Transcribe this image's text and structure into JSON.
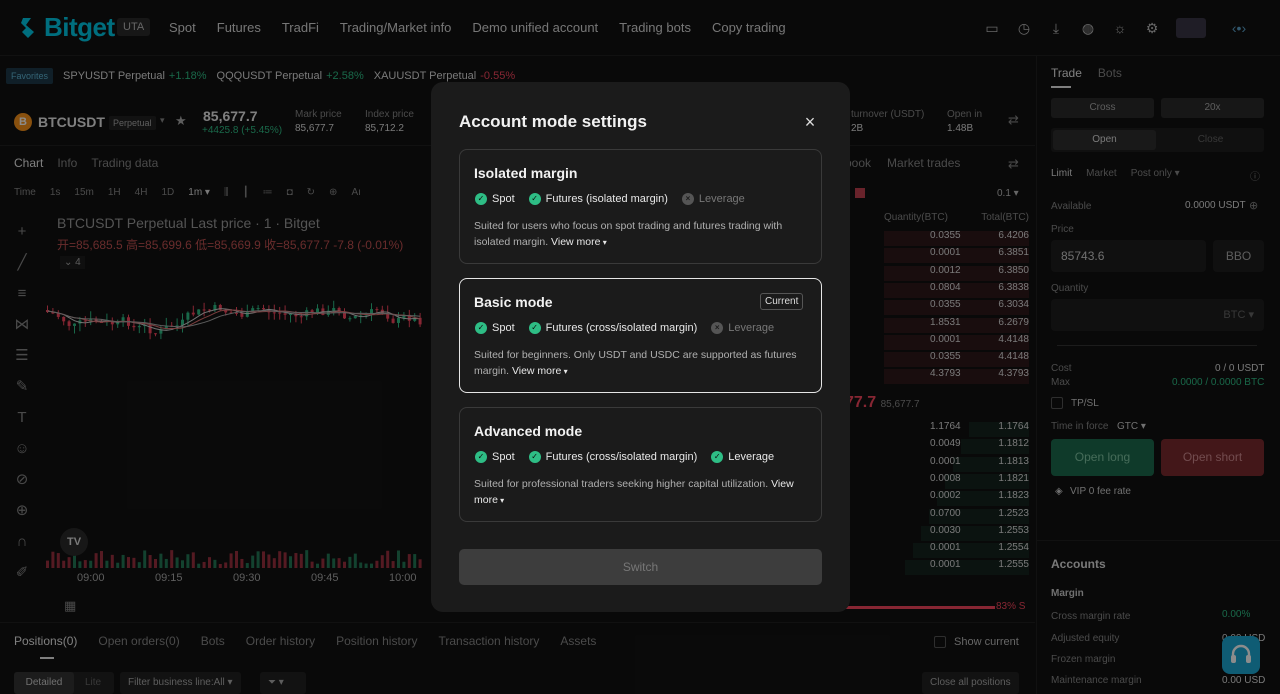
{
  "nav": {
    "logo": "Bitget",
    "uta": "UTA",
    "items": [
      "Spot",
      "Futures",
      "TradFi",
      "Trading/Market info",
      "Demo unified account",
      "Trading bots",
      "Copy trading"
    ]
  },
  "favorites": {
    "tag": "Favorites",
    "items": [
      {
        "symbol": "SPYUSDT Perpetual",
        "change": "+1.18%"
      },
      {
        "symbol": "QQQUSDT Perpetual",
        "change": "+2.58%"
      },
      {
        "symbol": "XAUUSDT Perpetual",
        "change": "-0.55%"
      }
    ]
  },
  "ticker": {
    "coin_icon": "B",
    "symbol": "BTCUSDT",
    "type": "Perpetual",
    "price": "85,677.7",
    "change": "+4425.8 (+5.45%)",
    "mark_label": "Mark price",
    "mark_value": "85,677.7",
    "index_label": "Index price",
    "index_value": "85,712.2",
    "turnover_label": "turnover (USDT)",
    "turnover_value": "2B",
    "oi_label": "Open in",
    "oi_value": "1.48B"
  },
  "chart": {
    "tabs": [
      "Chart",
      "Info",
      "Trading data"
    ],
    "timeframes": [
      "Time",
      "1s",
      "15m",
      "1H",
      "4H",
      "1D",
      "1m ▾"
    ],
    "title": "BTCUSDT Perpetual Last price · 1 · Bitget",
    "ohlc": "开=85,685.5 高=85,699.6 低=85,669.9 收=85,677.7 -7.8 (-0.01%)",
    "indicator_count": "4",
    "time_labels": [
      "09:00",
      "09:15",
      "09:30",
      "09:45",
      "10:00"
    ]
  },
  "orderbook": {
    "tabs": [
      "book",
      "Market trades"
    ],
    "step": "0.1 ▾",
    "header_qty": "Quantity(BTC)",
    "header_total": "Total(BTC)",
    "asks": [
      [
        "0.0355",
        "6.4206"
      ],
      [
        "0.0001",
        "6.3851"
      ],
      [
        "0.0012",
        "6.3850"
      ],
      [
        "0.0804",
        "6.3838"
      ],
      [
        "0.0355",
        "6.3034"
      ],
      [
        "1.8531",
        "6.2679"
      ],
      [
        "0.0001",
        "4.4148"
      ],
      [
        "0.0355",
        "4.4148"
      ],
      [
        "4.3793",
        "4.3793"
      ]
    ],
    "mid_price": "77.7",
    "mid_sub": "85,677.7",
    "bids": [
      [
        "1.1764",
        "1.1764"
      ],
      [
        "0.0049",
        "1.1812"
      ],
      [
        "0.0001",
        "1.1813"
      ],
      [
        "0.0008",
        "1.1821"
      ],
      [
        "0.0002",
        "1.1823"
      ],
      [
        "0.0700",
        "1.2523"
      ],
      [
        "0.0030",
        "1.2553"
      ],
      [
        "0.0001",
        "1.2554"
      ],
      [
        "0.0001",
        "1.2555"
      ]
    ],
    "ratio": "83% S"
  },
  "trade": {
    "tabs": [
      "Trade",
      "Bots"
    ],
    "margin_mode": "Cross",
    "leverage": "20x",
    "open": "Open",
    "close": "Close",
    "order_types": [
      "Limit",
      "Market",
      "Post only ▾"
    ],
    "available_label": "Available",
    "available_value": "0.0000 USDT",
    "price_label": "Price",
    "price_value": "85743.6",
    "bbo": "BBO",
    "quantity_label": "Quantity",
    "quantity_unit": "BTC ▾",
    "cost_label": "Cost",
    "cost_value": "0 / 0 USDT",
    "max_label": "Max",
    "max_value": "0.0000 / 0.0000 BTC",
    "tpsl": "TP/SL",
    "tif_label": "Time in force",
    "tif_value": "GTC ▾",
    "open_long": "Open long",
    "open_short": "Open short",
    "vip": "VIP 0  fee rate",
    "accounts_title": "Accounts",
    "margin_title": "Margin",
    "cross_rate_label": "Cross margin rate",
    "cross_rate_value": "0.00%",
    "adj_equity_label": "Adjusted equity",
    "adj_equity_value": "0.00 USD",
    "frozen_label": "Frozen margin",
    "maint_label": "Maintenance margin",
    "maint_value": "0.00 USD"
  },
  "bottom": {
    "tabs": [
      "Positions(0)",
      "Open orders(0)",
      "Bots",
      "Order history",
      "Position history",
      "Transaction history",
      "Assets"
    ],
    "show_current": "Show current",
    "detailed": "Detailed",
    "lite": "Lite",
    "filter": "Filter business line:All ▾",
    "close_all": "Close all positions"
  },
  "modal": {
    "title": "Account mode settings",
    "close_glyph": "×",
    "cards": [
      {
        "title": "Isolated margin",
        "features": [
          {
            "label": "Spot",
            "enabled": true
          },
          {
            "label": "Futures (isolated margin)",
            "enabled": true
          },
          {
            "label": "Leverage",
            "enabled": false
          }
        ],
        "desc": "Suited for users who focus on spot trading and futures trading with isolated margin.",
        "view_more": "View more",
        "current": ""
      },
      {
        "title": "Basic mode",
        "features": [
          {
            "label": "Spot",
            "enabled": true
          },
          {
            "label": "Futures (cross/isolated margin)",
            "enabled": true
          },
          {
            "label": "Leverage",
            "enabled": false
          }
        ],
        "desc": "Suited for beginners. Only USDT and USDC are supported as futures margin.",
        "view_more": "View more",
        "current": "Current"
      },
      {
        "title": "Advanced mode",
        "features": [
          {
            "label": "Spot",
            "enabled": true
          },
          {
            "label": "Futures (cross/isolated margin)",
            "enabled": true
          },
          {
            "label": "Leverage",
            "enabled": true
          }
        ],
        "desc": "Suited for professional traders seeking higher capital utilization.",
        "view_more": "View more",
        "current": ""
      }
    ],
    "switch_label": "Switch"
  }
}
